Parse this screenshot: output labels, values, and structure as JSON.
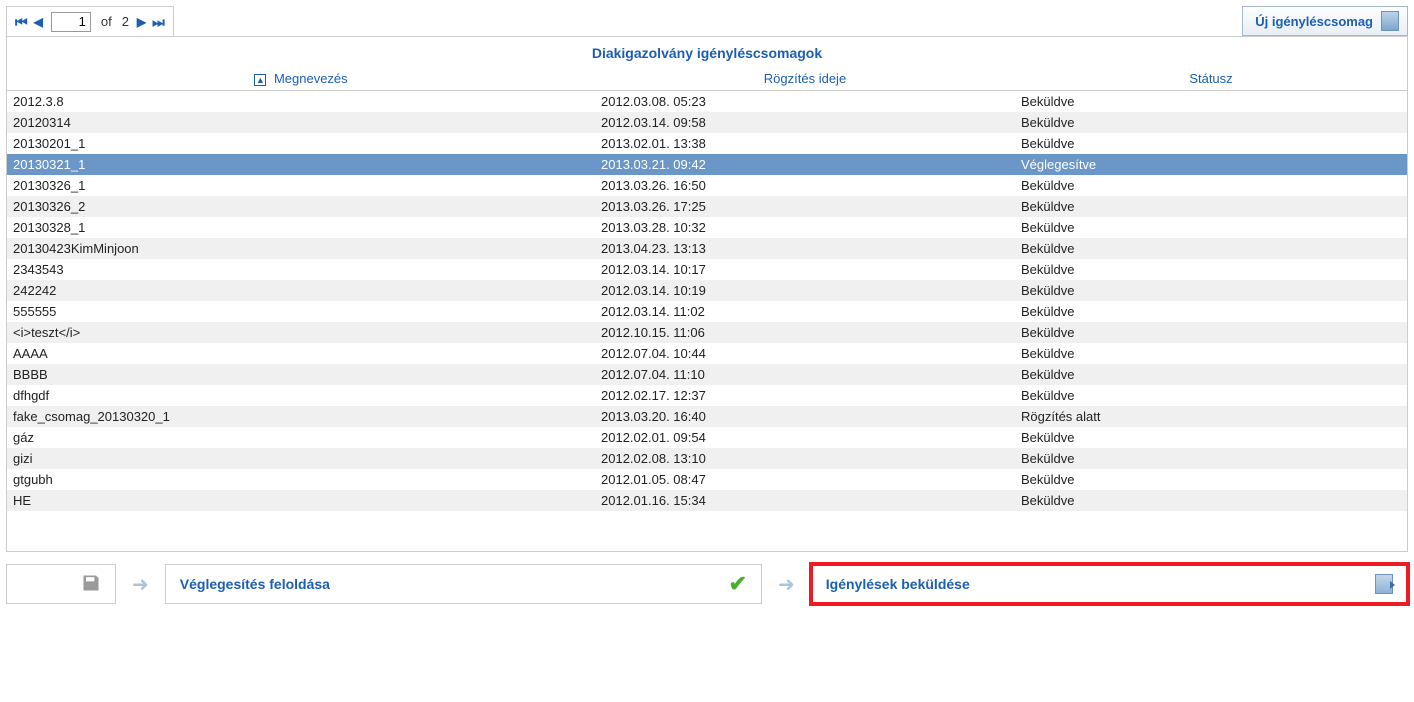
{
  "paginator": {
    "current_page": "1",
    "of_label": "of",
    "total_pages": "2"
  },
  "new_button_label": "Új igényléscsomag",
  "panel_title": "Diakigazolvány igényléscsomagok",
  "columns": {
    "name": "Megnevezés",
    "date": "Rögzítés ideje",
    "status": "Státusz"
  },
  "rows": [
    {
      "name": "2012.3.8",
      "date": "2012.03.08. 05:23",
      "status": "Beküldve",
      "selected": false
    },
    {
      "name": "20120314",
      "date": "2012.03.14. 09:58",
      "status": "Beküldve",
      "selected": false
    },
    {
      "name": "20130201_1",
      "date": "2013.02.01. 13:38",
      "status": "Beküldve",
      "selected": false
    },
    {
      "name": "20130321_1",
      "date": "2013.03.21. 09:42",
      "status": "Véglegesítve",
      "selected": true
    },
    {
      "name": "20130326_1",
      "date": "2013.03.26. 16:50",
      "status": "Beküldve",
      "selected": false
    },
    {
      "name": "20130326_2",
      "date": "2013.03.26. 17:25",
      "status": "Beküldve",
      "selected": false
    },
    {
      "name": "20130328_1",
      "date": "2013.03.28. 10:32",
      "status": "Beküldve",
      "selected": false
    },
    {
      "name": "20130423KimMinjoon",
      "date": "2013.04.23. 13:13",
      "status": "Beküldve",
      "selected": false
    },
    {
      "name": "2343543",
      "date": "2012.03.14. 10:17",
      "status": "Beküldve",
      "selected": false
    },
    {
      "name": "242242",
      "date": "2012.03.14. 10:19",
      "status": "Beküldve",
      "selected": false
    },
    {
      "name": "555555",
      "date": "2012.03.14. 11:02",
      "status": "Beküldve",
      "selected": false
    },
    {
      "name": "<i>teszt</i>",
      "date": "2012.10.15. 11:06",
      "status": "Beküldve",
      "selected": false
    },
    {
      "name": "AAAA",
      "date": "2012.07.04. 10:44",
      "status": "Beküldve",
      "selected": false
    },
    {
      "name": "BBBB",
      "date": "2012.07.04. 11:10",
      "status": "Beküldve",
      "selected": false
    },
    {
      "name": "dfhgdf",
      "date": "2012.02.17. 12:37",
      "status": "Beküldve",
      "selected": false
    },
    {
      "name": "fake_csomag_20130320_1",
      "date": "2013.03.20. 16:40",
      "status": "Rögzítés alatt",
      "selected": false
    },
    {
      "name": "gáz",
      "date": "2012.02.01. 09:54",
      "status": "Beküldve",
      "selected": false
    },
    {
      "name": "gizi",
      "date": "2012.02.08. 13:10",
      "status": "Beküldve",
      "selected": false
    },
    {
      "name": "gtgubh",
      "date": "2012.01.05. 08:47",
      "status": "Beküldve",
      "selected": false
    },
    {
      "name": "HE",
      "date": "2012.01.16. 15:34",
      "status": "Beküldve",
      "selected": false
    }
  ],
  "bottom": {
    "unlock_label": "Véglegesítés feloldása",
    "submit_label": "Igénylések beküldése"
  }
}
